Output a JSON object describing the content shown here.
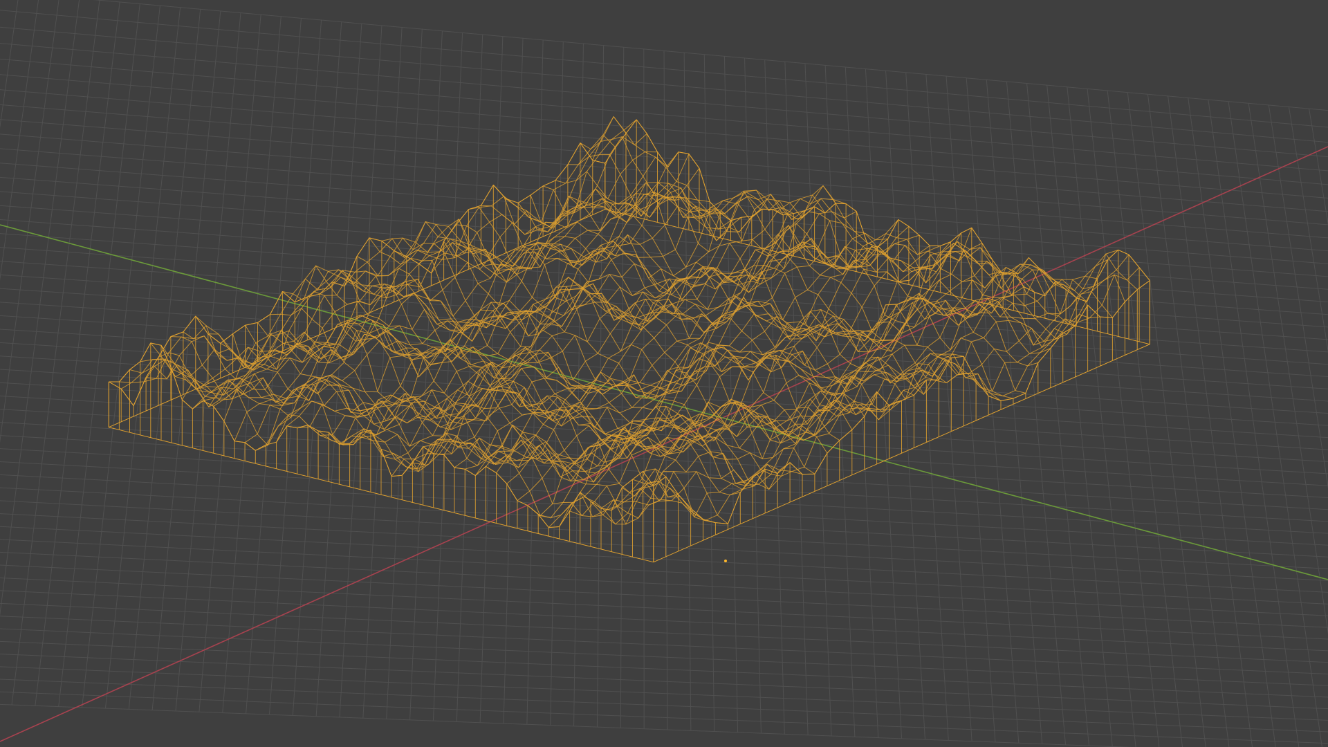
{
  "viewport": {
    "view": "3D Viewport",
    "shading": "wireframe",
    "background_color": "#3f3f3f",
    "grid_color": "#505050",
    "axis_x_color": "#a8424f",
    "axis_y_color": "#6b9a3a"
  },
  "object": {
    "type": "terrain-mesh",
    "selected": true,
    "wire_color": "#e0a12f",
    "vertex_color": "#ffb82a"
  }
}
